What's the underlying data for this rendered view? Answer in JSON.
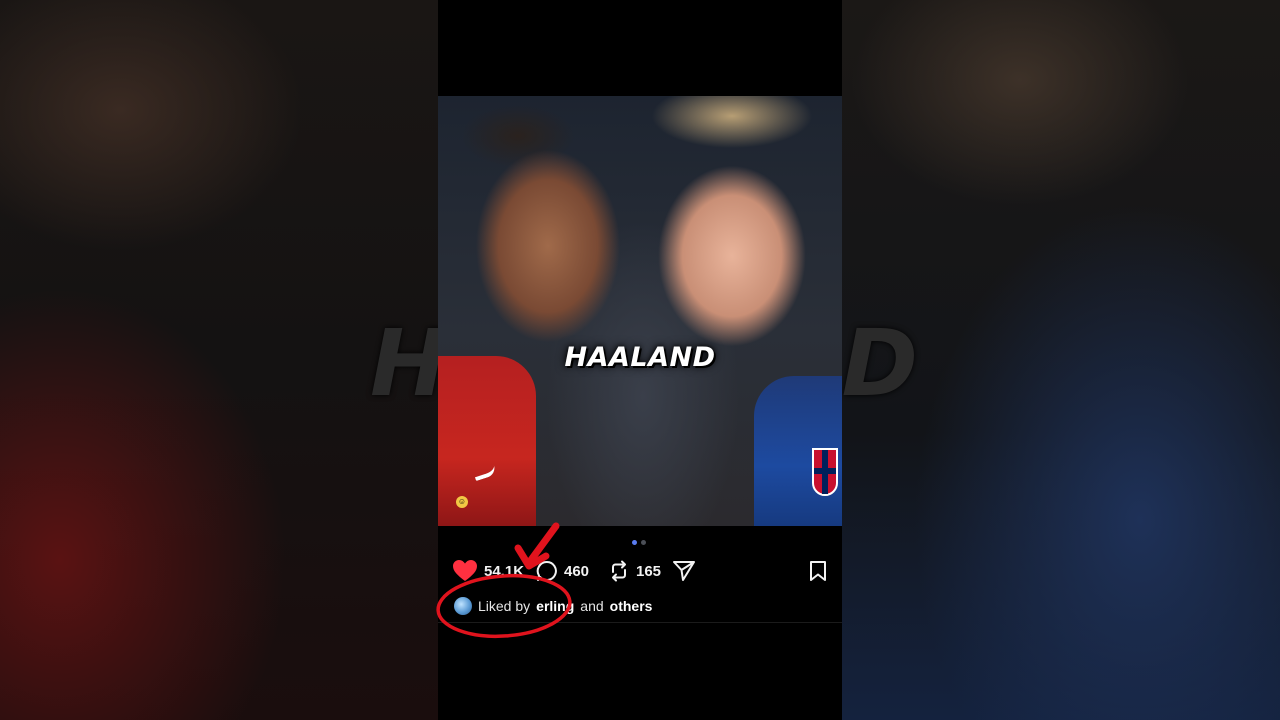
{
  "background": {
    "left_text": "HA",
    "right_text": "D"
  },
  "post": {
    "caption": "HAALAND",
    "carousel": {
      "count": 2,
      "active": 0
    },
    "actions": {
      "likes": "54.1K",
      "comments": "460",
      "reposts": "165"
    },
    "liked_by": {
      "prefix": "Liked by",
      "user": "erling",
      "connector": "and",
      "suffix": "others"
    }
  },
  "colors": {
    "heart": "#ff3040",
    "annotation": "#e0131d",
    "dot_active": "#5a7cf0"
  },
  "icons": [
    "heart-icon",
    "comment-icon",
    "repost-icon",
    "share-icon",
    "bookmark-icon"
  ]
}
